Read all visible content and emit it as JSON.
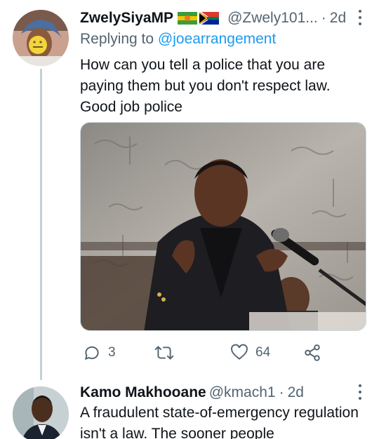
{
  "tweets": [
    {
      "display_name": "ZwelySiyaMP",
      "flag_icons": [
        "sunburst-flag-icon",
        "south-africa-flag-icon"
      ],
      "handle": "@Zwely101...",
      "separator": "·",
      "time": "2d",
      "replying_prefix": "Replying to",
      "replying_to": "@joearrangement",
      "text": "How can you tell a police that you are paying them but you don't respect law. Good job police",
      "media": "photo-man-speaking-at-microphone",
      "actions": {
        "reply_count": "3",
        "retweet_count": "",
        "like_count": "64"
      }
    },
    {
      "display_name": "Kamo Makhooane",
      "handle": "@kmach1",
      "separator": "·",
      "time": "2d",
      "text": "A fraudulent state-of-emergency regulation isn't a law. The sooner people"
    }
  ],
  "colors": {
    "text": "#0f1419",
    "secondary": "#536471",
    "link": "#1d9bf0",
    "thread_line": "#c4cfd6"
  },
  "icons": [
    "reply-icon",
    "retweet-icon",
    "like-icon",
    "share-icon",
    "more-icon"
  ]
}
